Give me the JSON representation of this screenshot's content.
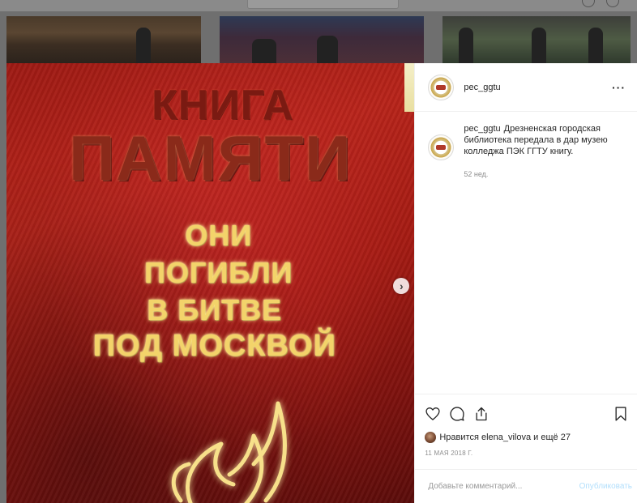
{
  "post": {
    "username": "pec_ggtu",
    "more_label": "···",
    "caption_user": "pec_ggtu",
    "caption_text": "Дрезненская городская библиотека передала в дар музею колледжа ПЭК ГГТУ книгу.",
    "caption_time": "52 нед.",
    "likes_text": "Нравится elena_vilova и ещё 27",
    "date": "11 МАЯ 2018 Г.",
    "comment_placeholder": "Добавьте комментарий...",
    "publish_label": "Опубликовать",
    "next_arrow": "›"
  },
  "cover": {
    "line1": "КНИГА",
    "line2": "ПАМЯТИ",
    "line3": "ОНИ",
    "line4": "ПОГИБЛИ",
    "line5": "В БИТВЕ",
    "line6": "ПОД МОСКВОЙ"
  },
  "icons": {
    "like": "heart-icon",
    "comment": "comment-icon",
    "share": "share-icon",
    "save": "bookmark-icon",
    "more": "more-icon",
    "next": "chevron-right-icon"
  },
  "colors": {
    "cover_red": "#a81c14",
    "gold": "#f3d36a",
    "text": "#262626",
    "muted": "#8e8e8e",
    "link_disabled": "#b2dffc"
  }
}
